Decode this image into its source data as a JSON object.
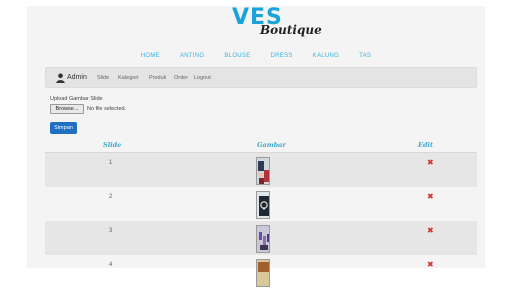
{
  "brand": {
    "name_top": "VES",
    "name_bottom": "Boutique"
  },
  "main_nav": [
    "HOME",
    "ANTING",
    "BLOUSE",
    "DRESS",
    "KALUNG",
    "TAS"
  ],
  "admin_bar": {
    "user_label": "Admin",
    "links": [
      "Slide",
      "Kategori",
      "Produk",
      "Order",
      "Logout"
    ]
  },
  "upload": {
    "label": "Upload Gambar Slide",
    "browse_label": "Browse...",
    "file_status": "No file selected.",
    "submit_label": "Simpan"
  },
  "table": {
    "headers": {
      "slide": "Slide",
      "gambar": "Gambar",
      "edit": "Edit"
    },
    "rows": [
      {
        "slide": "1"
      },
      {
        "slide": "2"
      },
      {
        "slide": "3"
      },
      {
        "slide": "4"
      }
    ],
    "delete_symbol": "✖"
  },
  "colors": {
    "accent": "#39b3e0",
    "button": "#1f6fc2",
    "delete": "#d9302a"
  }
}
